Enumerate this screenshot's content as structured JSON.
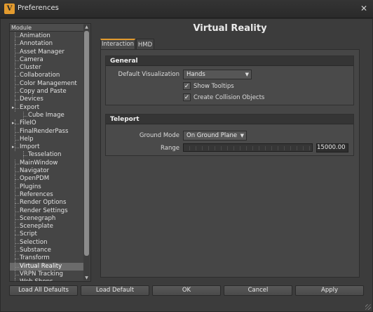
{
  "window": {
    "title": "Preferences",
    "app_icon_letter": "V",
    "close_symbol": "✕"
  },
  "sidebar": {
    "header": "Module",
    "items": [
      {
        "label": "Animation",
        "level": 0,
        "expandable": false
      },
      {
        "label": "Annotation",
        "level": 0,
        "expandable": false
      },
      {
        "label": "Asset Manager",
        "level": 0,
        "expandable": false
      },
      {
        "label": "Camera",
        "level": 0,
        "expandable": false
      },
      {
        "label": "Cluster",
        "level": 0,
        "expandable": false
      },
      {
        "label": "Collaboration",
        "level": 0,
        "expandable": false
      },
      {
        "label": "Color Management",
        "level": 0,
        "expandable": false
      },
      {
        "label": "Copy and Paste",
        "level": 0,
        "expandable": false
      },
      {
        "label": "Devices",
        "level": 0,
        "expandable": false
      },
      {
        "label": "Export",
        "level": 0,
        "expandable": true
      },
      {
        "label": "Cube Image",
        "level": 1,
        "expandable": false
      },
      {
        "label": "FileIO",
        "level": 0,
        "expandable": true
      },
      {
        "label": "FinalRenderPass",
        "level": 0,
        "expandable": false
      },
      {
        "label": "Help",
        "level": 0,
        "expandable": false
      },
      {
        "label": "Import",
        "level": 0,
        "expandable": true
      },
      {
        "label": "Tesselation",
        "level": 1,
        "expandable": false
      },
      {
        "label": "MainWindow",
        "level": 0,
        "expandable": false
      },
      {
        "label": "Navigator",
        "level": 0,
        "expandable": false
      },
      {
        "label": "OpenPDM",
        "level": 0,
        "expandable": false
      },
      {
        "label": "Plugins",
        "level": 0,
        "expandable": false
      },
      {
        "label": "References",
        "level": 0,
        "expandable": false
      },
      {
        "label": "Render Options",
        "level": 0,
        "expandable": false
      },
      {
        "label": "Render Settings",
        "level": 0,
        "expandable": false
      },
      {
        "label": "Scenegraph",
        "level": 0,
        "expandable": false
      },
      {
        "label": "Sceneplate",
        "level": 0,
        "expandable": false
      },
      {
        "label": "Script",
        "level": 0,
        "expandable": false
      },
      {
        "label": "Selection",
        "level": 0,
        "expandable": false
      },
      {
        "label": "Substance",
        "level": 0,
        "expandable": false
      },
      {
        "label": "Transform",
        "level": 0,
        "expandable": false
      },
      {
        "label": "Virtual Reality",
        "level": 0,
        "expandable": false,
        "selected": true
      },
      {
        "label": "VRPN Tracking",
        "level": 0,
        "expandable": false
      },
      {
        "label": "Web Shops",
        "level": 0,
        "expandable": false
      }
    ]
  },
  "main": {
    "title": "Virtual Reality",
    "tabs": [
      {
        "label": "Interaction",
        "active": true
      },
      {
        "label": "HMD",
        "active": false
      }
    ],
    "general": {
      "header": "General",
      "default_viz_label": "Default Visualization",
      "default_viz_value": "Hands",
      "show_tooltips_label": "Show Tooltips",
      "show_tooltips_checked": true,
      "collision_label": "Create Collision Objects",
      "collision_checked": true,
      "check_mark": "✓"
    },
    "teleport": {
      "header": "Teleport",
      "ground_mode_label": "Ground Mode",
      "ground_mode_value": "On Ground Plane",
      "range_label": "Range",
      "range_value": "15000.00",
      "range_slider_fraction": 1.0
    }
  },
  "footer": {
    "load_all_defaults": "Load All Defaults",
    "load_default": "Load Default",
    "ok": "OK",
    "cancel": "Cancel",
    "apply": "Apply"
  },
  "colors": {
    "accent": "#e39b2e",
    "background": "#3c3c3c",
    "selected_row": "#6b6b6b"
  }
}
